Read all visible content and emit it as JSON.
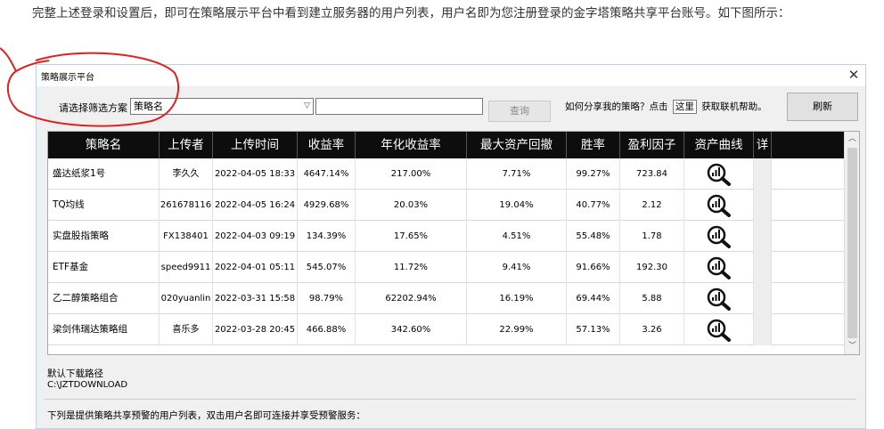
{
  "article": {
    "paragraph": "完整上述登录和设置后，即可在策略展示平台中看到建立服务器的用户列表，用户名即为您注册登录的金字塔策略共享平台账号。如下图所示："
  },
  "window": {
    "title": "策略展示平台",
    "close": "✕"
  },
  "toolbar": {
    "filter_label": "请选择筛选方案",
    "filter_value": "策略名",
    "query_label": "查询",
    "help_prefix": "如何分享我的策略？点击",
    "help_link": "这里",
    "help_suffix": "获取联机帮助。",
    "refresh_label": "刷新"
  },
  "table": {
    "columns": [
      "策略名",
      "上传者",
      "上传时间",
      "收益率",
      "年化收益率",
      "最大资产回撤",
      "胜率",
      "盈利因子",
      "资产曲线",
      "详"
    ],
    "rows": [
      [
        "盛达纸浆1号",
        "李久久",
        "2022-04-05 18:33",
        "4647.14%",
        "217.00%",
        "7.71%",
        "99.27%",
        "723.84"
      ],
      [
        "TQ均线",
        "261678116",
        "2022-04-05 16:24",
        "4929.68%",
        "20.03%",
        "19.04%",
        "40.77%",
        "2.12"
      ],
      [
        "实盘股指策略",
        "FX138401",
        "2022-04-03 09:19",
        "134.39%",
        "17.65%",
        "4.51%",
        "55.48%",
        "1.78"
      ],
      [
        "ETF基金",
        "speed9911",
        "2022-04-01 05:11",
        "545.07%",
        "11.72%",
        "9.41%",
        "91.66%",
        "192.30"
      ],
      [
        "乙二醇策略组合",
        "020yuanlin",
        "2022-03-31 15:58",
        "98.79%",
        "62202.94%",
        "16.19%",
        "69.44%",
        "5.88"
      ],
      [
        "梁剑伟瑞达策略组",
        "喜乐多",
        "2022-03-28 20:45",
        "466.88%",
        "342.60%",
        "22.99%",
        "57.13%",
        "3.26"
      ]
    ]
  },
  "download": {
    "label": "默认下载路径",
    "path": "C:\\JZTDOWNLOAD"
  },
  "list_note": "下列是提供策略共享预警的用户列表，双击用户名即可连接并享受预警服务：",
  "colors": {
    "header_bg": "#0d0d0d",
    "annotation": "#e02020",
    "window_border": "#b9d1ea"
  },
  "icons": {
    "asset_curve": "magnifier-chart-icon",
    "close": "close-icon",
    "dropdown": "chevron-down-icon"
  }
}
